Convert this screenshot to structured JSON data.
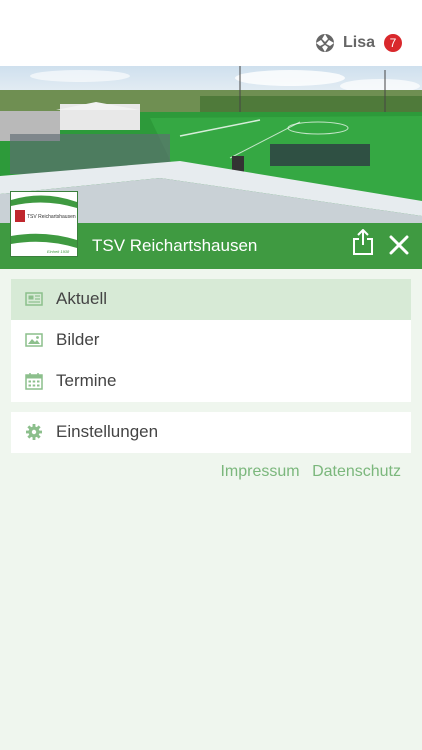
{
  "header": {
    "user_name": "Lisa",
    "notification_count": "7"
  },
  "club": {
    "name": "TSV Reichartshausen",
    "logo_text": "TSV Reichartshausen",
    "logo_motto": "Einheit 1938"
  },
  "menu": [
    {
      "label": "Aktuell",
      "icon": "newspaper-icon",
      "active": true
    },
    {
      "label": "Bilder",
      "icon": "image-icon",
      "active": false
    },
    {
      "label": "Termine",
      "icon": "calendar-icon",
      "active": false
    }
  ],
  "settings": {
    "label": "Einstellungen",
    "icon": "gear-icon"
  },
  "footer": {
    "impressum": "Impressum",
    "datenschutz": "Datenschutz"
  },
  "colors": {
    "brand_green": "#3f9a41",
    "active_bg": "#d7ead6",
    "page_bg": "#eff6ee",
    "badge_red": "#d9282c",
    "link_green": "#7bb77c"
  }
}
